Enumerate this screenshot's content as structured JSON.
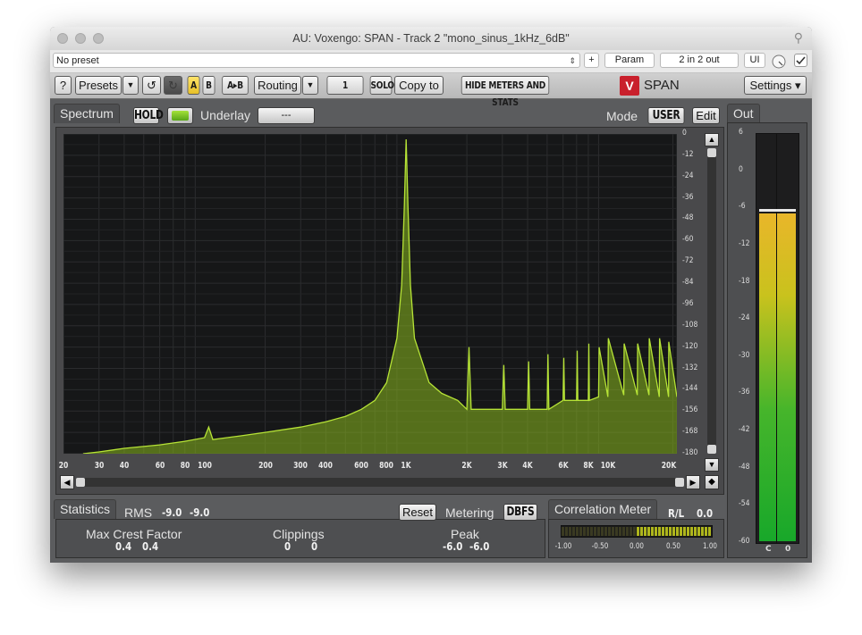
{
  "window": {
    "title": "AU: Voxengo: SPAN - Track 2 \"mono_sinus_1kHz_6dB\""
  },
  "host": {
    "preset": "No preset",
    "plus": "+",
    "param": "Param",
    "io": "2 in 2 out",
    "ui": "UI"
  },
  "toolbar": {
    "help": "?",
    "presets": "Presets",
    "a": "A",
    "b": "B",
    "ab": "A▸B",
    "routing": "Routing",
    "channel": "1",
    "solo": "SOLO",
    "copy_to": "Copy to",
    "hide_meters": "HIDE METERS AND STATS",
    "logo_text": "SPAN",
    "settings": "Settings ▾"
  },
  "spectrum": {
    "tab": "Spectrum",
    "hold": "HOLD",
    "underlay_label": "Underlay",
    "underlay_value": "---",
    "mode_label": "Mode",
    "mode_value": "USER",
    "edit": "Edit",
    "db_scale": [
      "0",
      "-12",
      "-24",
      "-36",
      "-48",
      "-60",
      "-72",
      "-84",
      "-96",
      "-108",
      "-120",
      "-132",
      "-144",
      "-156",
      "-168",
      "-180"
    ],
    "freq_scale": [
      "20",
      "30",
      "40",
      "60",
      "80",
      "100",
      "200",
      "300",
      "400",
      "600",
      "800",
      "1K",
      "2K",
      "3K",
      "4K",
      "6K",
      "8K",
      "10K",
      "20K"
    ]
  },
  "chart_data": {
    "type": "area",
    "title": "",
    "xlabel": "",
    "ylabel": "",
    "x_scale": "log",
    "xlim": [
      20,
      22000
    ],
    "ylim": [
      -180,
      0
    ],
    "grid": true,
    "color": "#8bb81f",
    "series": [
      {
        "points": [
          [
            25,
            -180
          ],
          [
            30,
            -179
          ],
          [
            40,
            -177
          ],
          [
            60,
            -175
          ],
          [
            80,
            -173
          ],
          [
            100,
            -171
          ],
          [
            105,
            -165
          ],
          [
            110,
            -172
          ],
          [
            150,
            -170
          ],
          [
            200,
            -168
          ],
          [
            300,
            -165
          ],
          [
            400,
            -162
          ],
          [
            500,
            -159
          ],
          [
            600,
            -155
          ],
          [
            700,
            -150
          ],
          [
            800,
            -140
          ],
          [
            900,
            -115
          ],
          [
            950,
            -85
          ],
          [
            980,
            -40
          ],
          [
            1000,
            -3
          ],
          [
            1020,
            -40
          ],
          [
            1050,
            -85
          ],
          [
            1100,
            -115
          ],
          [
            1300,
            -140
          ],
          [
            1500,
            -146
          ],
          [
            1800,
            -150
          ],
          [
            2000,
            -155
          ],
          [
            2050,
            -120
          ],
          [
            2100,
            -155
          ],
          [
            2500,
            -155
          ],
          [
            3000,
            -155
          ],
          [
            3050,
            -130
          ],
          [
            3100,
            -155
          ],
          [
            4000,
            -155
          ],
          [
            4050,
            -128
          ],
          [
            4100,
            -155
          ],
          [
            5000,
            -155
          ],
          [
            5050,
            -124
          ],
          [
            5100,
            -155
          ],
          [
            6000,
            -150
          ],
          [
            6050,
            -126
          ],
          [
            6100,
            -150
          ],
          [
            7000,
            -150
          ],
          [
            7050,
            -122
          ],
          [
            7100,
            -150
          ],
          [
            8000,
            -150
          ],
          [
            8050,
            -118
          ],
          [
            8100,
            -150
          ],
          [
            9000,
            -148
          ],
          [
            9050,
            -120
          ],
          [
            10000,
            -148
          ],
          [
            10050,
            -115
          ],
          [
            12000,
            -147
          ],
          [
            12050,
            -118
          ],
          [
            14000,
            -147
          ],
          [
            14050,
            -118
          ],
          [
            16000,
            -147
          ],
          [
            16050,
            -115
          ],
          [
            18000,
            -148
          ],
          [
            18050,
            -115
          ],
          [
            20000,
            -148
          ],
          [
            20050,
            -117
          ],
          [
            22000,
            -148
          ]
        ]
      }
    ]
  },
  "output": {
    "tab": "Out",
    "scale": [
      "6",
      "0",
      "-6",
      "-12",
      "-18",
      "-24",
      "-30",
      "-36",
      "-42",
      "-48",
      "-54",
      "-60"
    ],
    "level_db": -6,
    "ch_left": "C",
    "ch_right": "0"
  },
  "statistics": {
    "tab": "Statistics",
    "rms_label": "RMS",
    "rms_l": "-9.0",
    "rms_r": "-9.0",
    "reset": "Reset",
    "metering_label": "Metering",
    "metering_value": "DBFS",
    "mcf_label": "Max Crest Factor",
    "mcf_l": "0.4",
    "mcf_r": "0.4",
    "clip_label": "Clippings",
    "clip_l": "0",
    "clip_r": "0",
    "peak_label": "Peak",
    "peak_l": "-6.0",
    "peak_r": "-6.0"
  },
  "correlation": {
    "tab": "Correlation Meter",
    "rl_label": "R/L",
    "value": "0.0",
    "scale": [
      "-1.00",
      "-0.50",
      "0.00",
      "0.50",
      "1.00"
    ]
  }
}
